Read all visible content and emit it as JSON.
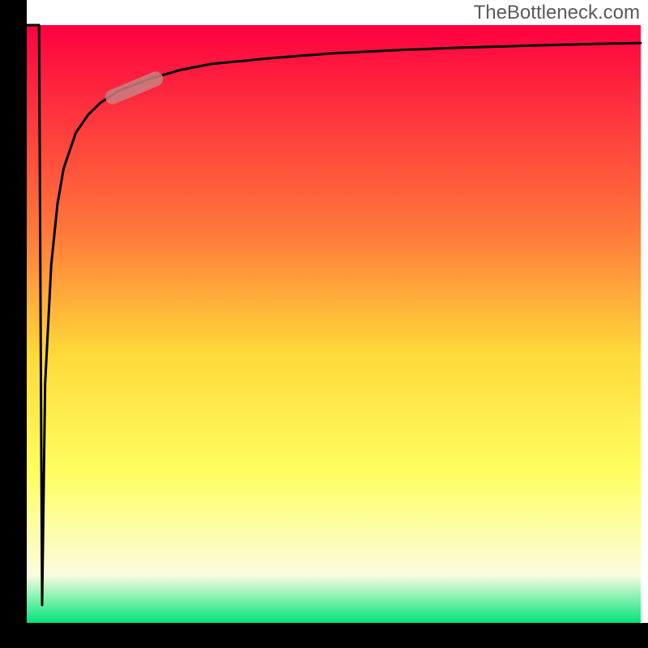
{
  "attribution": "TheBottleneck.com",
  "colors": {
    "grad_top": "#ff0040",
    "grad_mid1": "#ff7a3a",
    "grad_mid2": "#ffd93a",
    "grad_mid3": "#ffff60",
    "grad_bottom_pale": "#fbfce0",
    "grad_bottom": "#00e57a",
    "axis": "#000000",
    "curve": "#000000",
    "marker": "#c98080"
  },
  "chart_data": {
    "type": "line",
    "title": "",
    "xlabel": "",
    "ylabel": "",
    "xlim": [
      0,
      100
    ],
    "ylim": [
      0,
      100
    ],
    "series": [
      {
        "name": "bottleneck-curve",
        "x": [
          0,
          1,
          2,
          2.5,
          3,
          4,
          5,
          6,
          8,
          10,
          12,
          15,
          20,
          25,
          30,
          40,
          50,
          60,
          70,
          80,
          90,
          100
        ],
        "y": [
          100,
          100,
          100,
          3,
          40,
          60,
          70,
          76,
          82,
          85,
          87,
          89,
          91,
          92.5,
          93.5,
          94.5,
          95.3,
          95.8,
          96.2,
          96.5,
          96.8,
          97
        ]
      }
    ],
    "marker": {
      "name": "highlight-segment",
      "x_start": 14,
      "x_end": 21,
      "y_start": 88,
      "y_end": 91
    },
    "grid": false,
    "legend": false
  }
}
